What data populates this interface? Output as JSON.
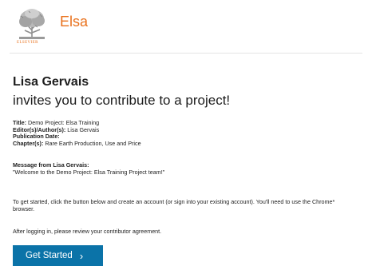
{
  "header": {
    "publisher_logo_text": "ELSEVIER",
    "app_name": "Elsa",
    "brand_color": "#e9711c"
  },
  "invite": {
    "inviter_name": "Lisa Gervais",
    "headline": "invites you to contribute to a project!"
  },
  "details": {
    "title_label": "Title:",
    "title_value": "Demo Project: Elsa Training",
    "editors_label": "Editor(s)/Author(s):",
    "editors_value": "Lisa Gervais",
    "publication_date_label": "Publication Date:",
    "publication_date_value": "",
    "chapters_label": "Chapter(s):",
    "chapters_value": "Rare Earth Production, Use and Price"
  },
  "message": {
    "heading": "Message from Lisa Gervais:",
    "body": "\"Welcome to the Demo Project: Elsa Training Project team!\""
  },
  "instructions": "To get started, click the button below and create an account (or sign into your existing account). You'll need to use the Chrome* browser.",
  "after_login": "After logging in, please review your contributor agreement.",
  "cta": {
    "label": "Get Started",
    "chevron": "›",
    "icon": "chevron-right-icon",
    "color": "#0b73a8"
  }
}
